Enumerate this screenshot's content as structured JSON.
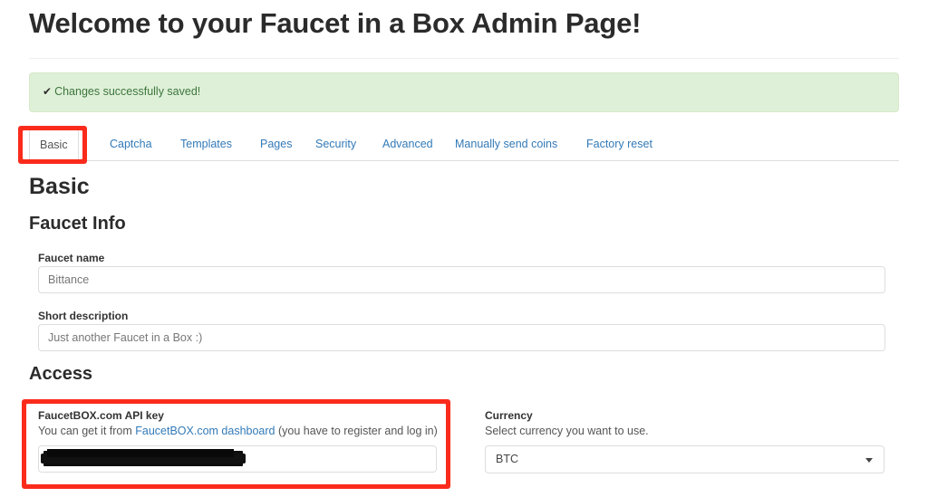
{
  "page": {
    "title": "Welcome to your Faucet in a Box Admin Page!"
  },
  "alert": {
    "icon": "check-icon",
    "glyph": "✔",
    "message": "Changes successfully saved!",
    "background_color": "#dff0d8",
    "text_color": "#3c763d"
  },
  "tabs": {
    "items": [
      {
        "label": "Basic",
        "active": true
      },
      {
        "label": "Captcha",
        "active": false
      },
      {
        "label": "Templates",
        "active": false
      },
      {
        "label": "Pages",
        "active": false
      },
      {
        "label": "Security",
        "active": false
      },
      {
        "label": "Advanced",
        "active": false
      },
      {
        "label": "Manually send coins",
        "active": false
      },
      {
        "label": "Factory reset",
        "active": false
      }
    ],
    "link_color": "#337ab7"
  },
  "main": {
    "heading": "Basic",
    "sections": [
      {
        "heading": "Faucet Info",
        "fields": [
          {
            "label": "Faucet name",
            "value": "Bittance",
            "placeholder": "Faucet name"
          },
          {
            "label": "Short description",
            "value": "Just another Faucet in a Box :)",
            "placeholder": "Short description"
          }
        ]
      },
      {
        "heading": "Access",
        "fields": [
          {
            "label": "FaucetBOX.com API key",
            "help_prefix": "You can get it from ",
            "help_link": "FaucetBOX.com dashboard",
            "help_suffix": " (you have to register and log in)",
            "value": "",
            "redacted": true,
            "placeholder": "FaucetBOX.com API key"
          },
          {
            "label": "Currency",
            "help": "Select currency you want to use.",
            "selected": "BTC",
            "options": [
              "BTC"
            ]
          }
        ]
      }
    ]
  },
  "annotations": {
    "color": "#fb2b1c",
    "boxes": [
      {
        "target": "tab-basic"
      },
      {
        "target": "api-key-group"
      }
    ]
  }
}
